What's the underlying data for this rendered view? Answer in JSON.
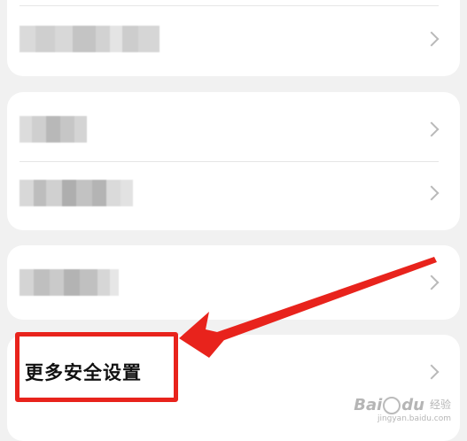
{
  "settings": {
    "rows": [
      {
        "label": null,
        "redacted": true
      },
      {
        "label": null,
        "redacted": true
      },
      {
        "label": null,
        "redacted": true
      },
      {
        "label": null,
        "redacted": true
      },
      {
        "label": "更多安全设置",
        "redacted": false
      }
    ]
  },
  "annotation": {
    "color": "#e8231c"
  },
  "watermark": {
    "brand": "Bai",
    "brand_suffix": "du",
    "product": "经验",
    "url": "jingyan.baidu.com"
  }
}
